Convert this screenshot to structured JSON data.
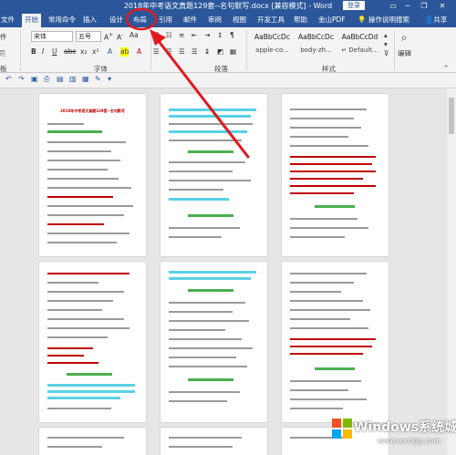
{
  "window": {
    "title": "2018年中考语文真题129套--名句默写.docx [兼容模式] - Word",
    "login_label": "登录",
    "restore_icon": "restore-icon",
    "minimize_glyph": "─",
    "maximize_glyph": "❐",
    "close_glyph": "✕"
  },
  "tabs": [
    {
      "label": "文件"
    },
    {
      "label": "开始"
    },
    {
      "label": "常用命令"
    },
    {
      "label": "插入"
    },
    {
      "label": "设计"
    },
    {
      "label": "布局"
    },
    {
      "label": "引用"
    },
    {
      "label": "邮件"
    },
    {
      "label": "审阅"
    },
    {
      "label": "视图"
    },
    {
      "label": "开发工具"
    },
    {
      "label": "帮助"
    },
    {
      "label": "金山PDF"
    },
    {
      "label": "操作说明搜索"
    }
  ],
  "share_label": "共享",
  "ribbon": {
    "font_name": "宋体",
    "font_size": "五号",
    "paste_label": "件",
    "clipboard_label": "板",
    "font_group": "字体",
    "paragraph_group": "段落",
    "styles_group": "样式",
    "edit_label": "编辑",
    "styles": [
      {
        "sample": "AaBbCcDc",
        "name": "apple-co..."
      },
      {
        "sample": "AaBbCcDc",
        "name": "body-zh..."
      },
      {
        "sample": "AaBbCcDd",
        "name": "↵ Default..."
      }
    ]
  },
  "document": {
    "page_title": "2018年中考语文真题129套--名句默写"
  },
  "annotation": {
    "color": "#e0191e"
  },
  "watermark": {
    "brand": "Windows系统城",
    "url": "www.wxclgg.com"
  }
}
